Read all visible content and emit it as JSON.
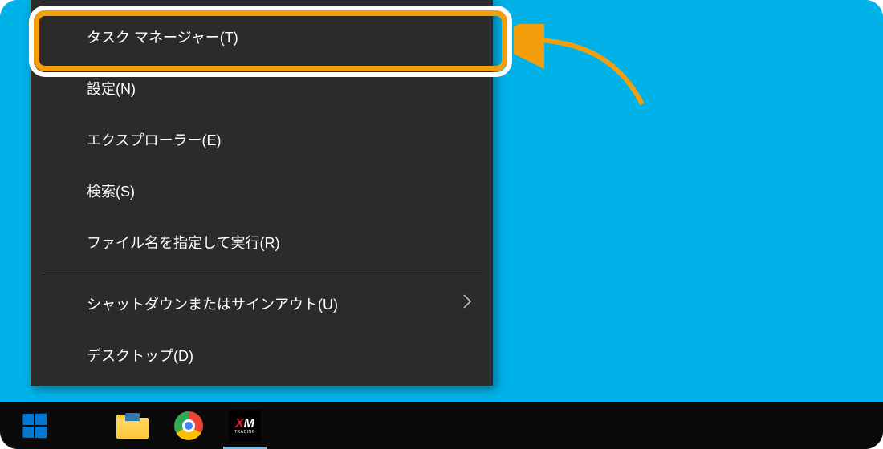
{
  "context_menu": {
    "items": [
      {
        "label": "タスク マネージャー(T)",
        "has_submenu": false
      },
      {
        "label": "設定(N)",
        "has_submenu": false
      },
      {
        "label": "エクスプローラー(E)",
        "has_submenu": false
      },
      {
        "label": "検索(S)",
        "has_submenu": false
      },
      {
        "label": "ファイル名を指定して実行(R)",
        "has_submenu": false
      },
      {
        "separator": true
      },
      {
        "label": "シャットダウンまたはサインアウト(U)",
        "has_submenu": true
      },
      {
        "label": "デスクトップ(D)",
        "has_submenu": false
      }
    ]
  },
  "taskbar": {
    "apps": [
      {
        "name": "file-explorer",
        "active": false
      },
      {
        "name": "chrome",
        "active": false
      },
      {
        "name": "xm-trading",
        "active": true
      }
    ]
  },
  "annotation": {
    "highlighted_item_index": 0,
    "highlight_color": "#f59e0b"
  }
}
